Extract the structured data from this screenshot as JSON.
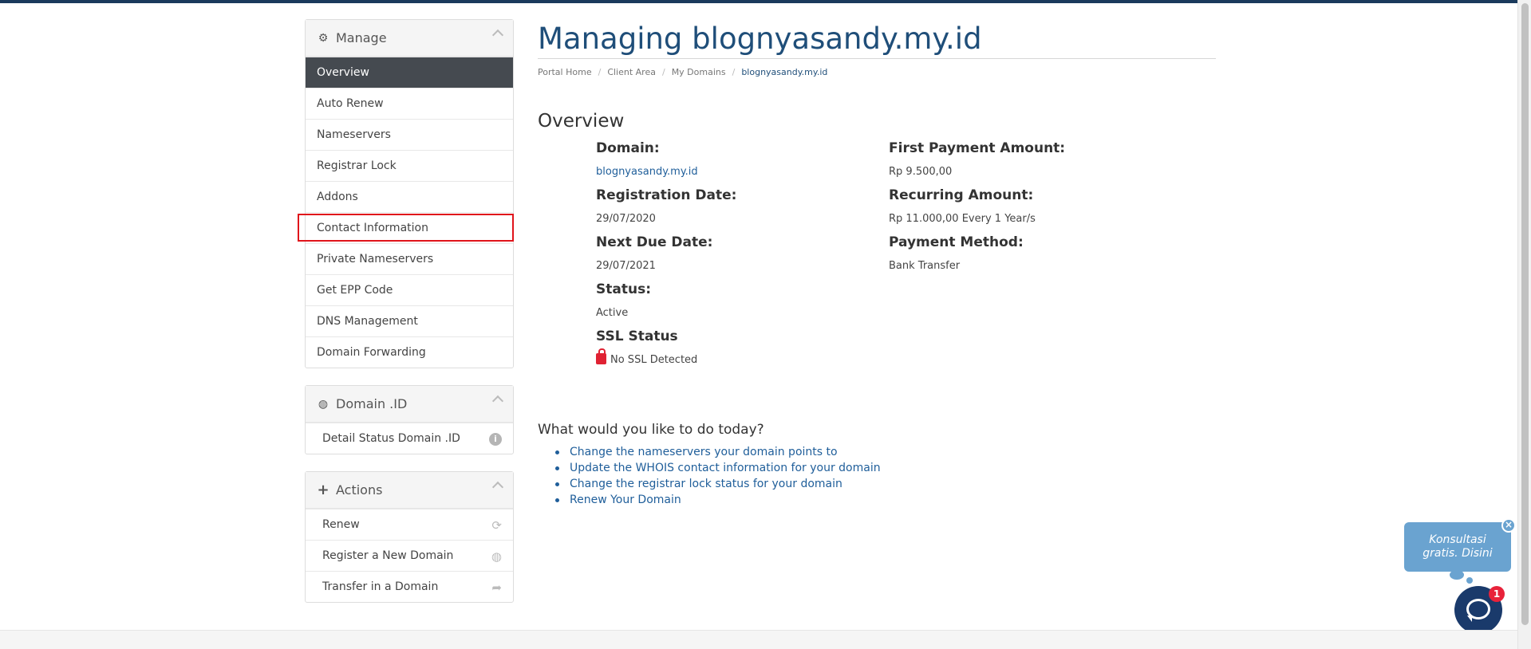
{
  "sidebar": {
    "manage": {
      "title": "Manage",
      "icon": "gear-icon",
      "items": [
        {
          "label": "Overview",
          "active": true
        },
        {
          "label": "Auto Renew"
        },
        {
          "label": "Nameservers"
        },
        {
          "label": "Registrar Lock"
        },
        {
          "label": "Addons"
        },
        {
          "label": "Contact Information"
        },
        {
          "label": "Private Nameservers"
        },
        {
          "label": "Get EPP Code"
        },
        {
          "label": "DNS Management"
        },
        {
          "label": "Domain Forwarding"
        }
      ]
    },
    "domain_id": {
      "title": "Domain .ID",
      "icon": "globe-icon",
      "items": [
        {
          "label": "Detail Status Domain .ID",
          "icon": "info-icon"
        }
      ]
    },
    "actions": {
      "title": "Actions",
      "icon": "plus-icon",
      "items": [
        {
          "label": "Renew",
          "icon": "refresh-icon"
        },
        {
          "label": "Register a New Domain",
          "icon": "globe-icon"
        },
        {
          "label": "Transfer in a Domain",
          "icon": "share-icon"
        }
      ]
    }
  },
  "main": {
    "title": "Managing blognyasandy.my.id",
    "breadcrumb": [
      "Portal Home",
      "Client Area",
      "My Domains",
      "blognyasandy.my.id"
    ],
    "section_title": "Overview",
    "left": [
      {
        "label": "Domain:",
        "value": "blognyasandy.my.id"
      },
      {
        "label": "Registration Date:",
        "value": "29/07/2020"
      },
      {
        "label": "Next Due Date:",
        "value": "29/07/2021"
      },
      {
        "label": "Status:",
        "value": "Active"
      },
      {
        "label": "SSL Status",
        "value": "No SSL Detected"
      }
    ],
    "right": [
      {
        "label": "First Payment Amount:",
        "value": "Rp 9.500,00"
      },
      {
        "label": "Recurring Amount:",
        "value": "Rp 11.000,00 Every 1 Year/s"
      },
      {
        "label": "Payment Method:",
        "value": "Bank Transfer"
      }
    ],
    "todo_title": "What would you like to do today?",
    "todo": [
      "Change the nameservers your domain points to",
      "Update the WHOIS contact information for your domain",
      "Change the registrar lock status for your domain",
      "Renew Your Domain"
    ]
  },
  "chat": {
    "bubble_line1": "Konsultasi",
    "bubble_line2": "gratis. Disini",
    "close": "×",
    "badge": "1"
  },
  "colors": {
    "accent": "#1f4e79",
    "link": "#1f5e9a",
    "active_item_bg": "#454a50",
    "highlight": "#e0141b",
    "chat_bubble": "#6aa3d0",
    "chat_button": "#1a3a6b"
  }
}
